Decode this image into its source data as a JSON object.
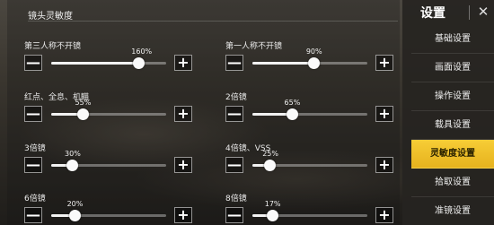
{
  "section_title": "镜头灵敏度",
  "settings": [
    {
      "label": "第三人称不开镜",
      "value_text": "160%",
      "level": 0.76
    },
    {
      "label": "第一人称不开镜",
      "value_text": "90%",
      "level": 0.53
    },
    {
      "label": "红点、全息、机瞄",
      "value_text": "55%",
      "level": 0.27
    },
    {
      "label": "2倍镜",
      "value_text": "65%",
      "level": 0.34
    },
    {
      "label": "3倍镜",
      "value_text": "30%",
      "level": 0.18
    },
    {
      "label": "4倍镜、VSS",
      "value_text": "25%",
      "level": 0.15
    },
    {
      "label": "6倍镜",
      "value_text": "20%",
      "level": 0.2
    },
    {
      "label": "8倍镜",
      "value_text": "17%",
      "level": 0.17
    }
  ],
  "buttons": {
    "minus": "—",
    "plus": "+"
  },
  "sidebar": {
    "title": "设置",
    "close_glyph": "✕",
    "items": [
      {
        "label": "基础设置",
        "active": false
      },
      {
        "label": "画面设置",
        "active": false
      },
      {
        "label": "操作设置",
        "active": false
      },
      {
        "label": "载具设置",
        "active": false
      },
      {
        "label": "灵敏度设置",
        "active": true
      },
      {
        "label": "拾取设置",
        "active": false
      },
      {
        "label": "准镜设置",
        "active": false
      }
    ]
  },
  "colors": {
    "accent": "#f2c12e",
    "track": "#8f8f8f",
    "fill": "#f2f2f2"
  }
}
